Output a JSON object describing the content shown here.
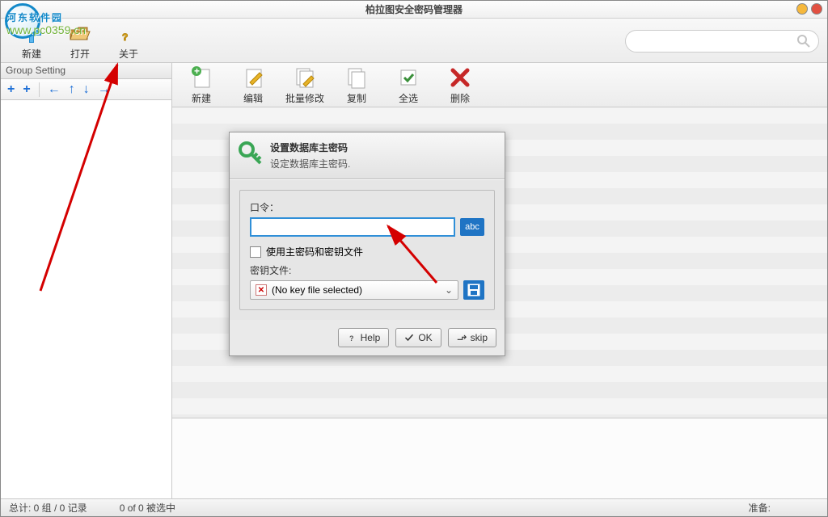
{
  "title": "柏拉图安全密码管理器",
  "logo": {
    "text": "河东软件园",
    "url": "www.pc0359.cn"
  },
  "toolbar1": {
    "new": "新建",
    "open": "打开",
    "about": "关于"
  },
  "sidebar": {
    "header": "Group Setting"
  },
  "toolbar2": {
    "new": "新建",
    "edit": "编辑",
    "batch": "批量修改",
    "copy": "复制",
    "selectall": "全选",
    "delete": "删除"
  },
  "dialog": {
    "title": "设置数据库主密码",
    "subtitle": "设定数据库主密码.",
    "password_label": "口令：",
    "abc": "abc",
    "use_keyfile": "使用主密码和密钥文件",
    "keyfile_label": "密钥文件:",
    "keyfile_value": "(No key file selected)",
    "help": "Help",
    "ok": "OK",
    "skip": "skip"
  },
  "status": {
    "total": "总计: 0 组 / 0 记录",
    "selected": "0 of 0 被选中",
    "ready": "准备:"
  }
}
